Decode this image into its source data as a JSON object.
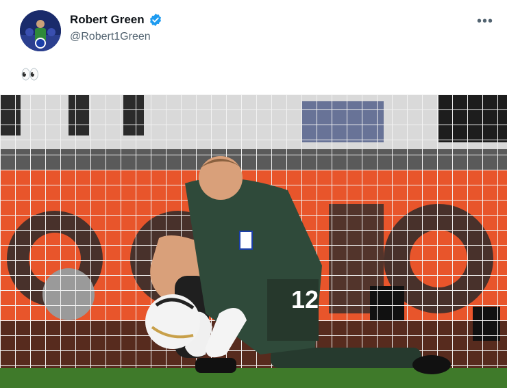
{
  "tweet": {
    "author_name": "Robert Green",
    "author_handle": "@Robert1Green",
    "text": "👀",
    "more_label": "•••"
  },
  "photo": {
    "jersey_number": "12"
  },
  "colors": {
    "verified_badge": "#1d9bf0",
    "handle_text": "#536471",
    "name_text": "#0f1419",
    "keeper_kit": "#2f4a3a",
    "board_orange": "#e8552b",
    "pitch": "#3f7a2a"
  },
  "icons": {
    "verified": "verified-badge-icon",
    "more": "more-options-icon"
  }
}
